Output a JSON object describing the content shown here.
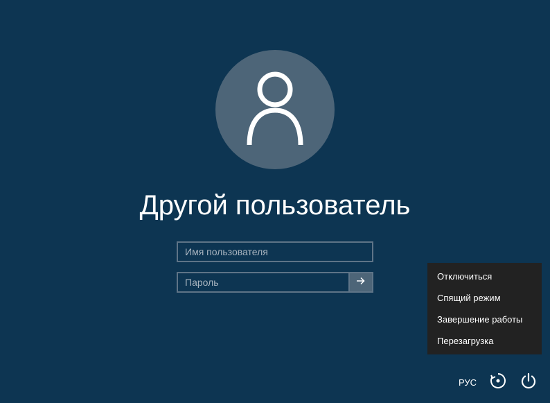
{
  "login": {
    "title": "Другой пользователь",
    "username_placeholder": "Имя пользователя",
    "password_placeholder": "Пароль"
  },
  "power_menu": {
    "items": [
      "Отключиться",
      "Спящий режим",
      "Завершение работы",
      "Перезагрузка"
    ]
  },
  "bottom_bar": {
    "language": "РУС"
  }
}
